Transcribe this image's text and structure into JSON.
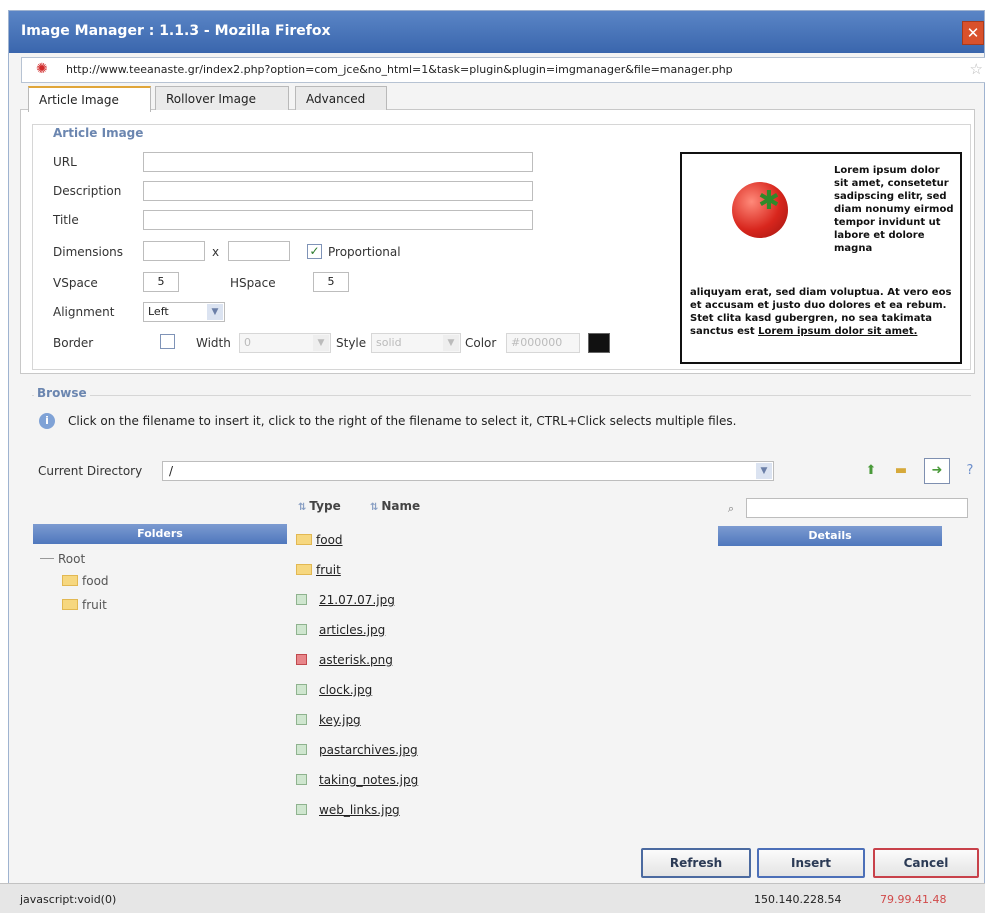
{
  "window": {
    "title": "Image Manager : 1.1.3 - Mozilla Firefox",
    "close_glyph": "✕",
    "url": "http://www.teeanaste.gr/index2.php?option=com_jce&no_html=1&task=plugin&plugin=imgmanager&file=manager.php"
  },
  "tabs": [
    {
      "label": "Article Image",
      "active": true
    },
    {
      "label": "Rollover Image",
      "active": false
    },
    {
      "label": "Advanced",
      "active": false
    }
  ],
  "article_image": {
    "legend": "Article Image",
    "url_label": "URL",
    "url_value": "",
    "description_label": "Description",
    "description_value": "",
    "title_label": "Title",
    "title_value": "",
    "dimensions_label": "Dimensions",
    "dimensions_sep": "x",
    "width_value": "",
    "height_value": "",
    "proportional_label": "Proportional",
    "proportional_checked": true,
    "vspace_label": "VSpace",
    "vspace_value": "5",
    "hspace_label": "HSpace",
    "hspace_value": "5",
    "alignment_label": "Alignment",
    "alignment_value": "Left",
    "border_label": "Border",
    "border_checked": false,
    "border_width_label": "Width",
    "border_width_value": "0",
    "border_style_label": "Style",
    "border_style_value": "solid",
    "border_color_label": "Color",
    "border_color_value": "#000000",
    "border_color_hex": "#111111"
  },
  "preview": {
    "text_right": "Lorem ipsum dolor sit amet, consetetur sadipscing elitr, sed diam nonumy eirmod tempor invidunt ut labore et dolore magna",
    "text_bottom": "aliquyam erat, sed diam voluptua. At vero eos et accusam et justo duo dolores et ea rebum. Stet clita kasd gubergren, no sea takimata sanctus est",
    "text_bottom_underlined": "Lorem ipsum dolor sit amet."
  },
  "browse": {
    "legend": "Browse",
    "info_text": "Click on the filename to insert it, click to the right of the filename to select it, CTRL+Click selects multiple files.",
    "current_directory_label": "Current Directory",
    "current_directory_value": "/",
    "folders_header": "Folders",
    "details_header": "Details",
    "type_header": "Type",
    "name_header": "Name",
    "tree": {
      "root": "Root",
      "children": [
        "food",
        "fruit"
      ]
    },
    "files": [
      {
        "name": "food",
        "kind": "folder"
      },
      {
        "name": "fruit",
        "kind": "folder"
      },
      {
        "name": "21.07.07.jpg",
        "kind": "jpg"
      },
      {
        "name": "articles.jpg",
        "kind": "jpg"
      },
      {
        "name": "asterisk.png",
        "kind": "png"
      },
      {
        "name": "clock.jpg",
        "kind": "jpg"
      },
      {
        "name": "key.jpg",
        "kind": "jpg"
      },
      {
        "name": "pastarchives.jpg",
        "kind": "jpg"
      },
      {
        "name": "taking_notes.jpg",
        "kind": "jpg"
      },
      {
        "name": "web_links.jpg",
        "kind": "jpg"
      }
    ]
  },
  "buttons": {
    "refresh": "Refresh",
    "insert": "Insert",
    "cancel": "Cancel"
  },
  "status": {
    "left": "javascript:void(0)",
    "ip_local": "150.140.228.54",
    "ip_remote": "79.99.41.48"
  },
  "colors": {
    "title_bar": "#4a76bb",
    "header_blue": "#5a80c2",
    "cancel_border": "#c8414a",
    "insert_border": "#4c6fb8",
    "refresh_border": "#4b6aa0"
  }
}
